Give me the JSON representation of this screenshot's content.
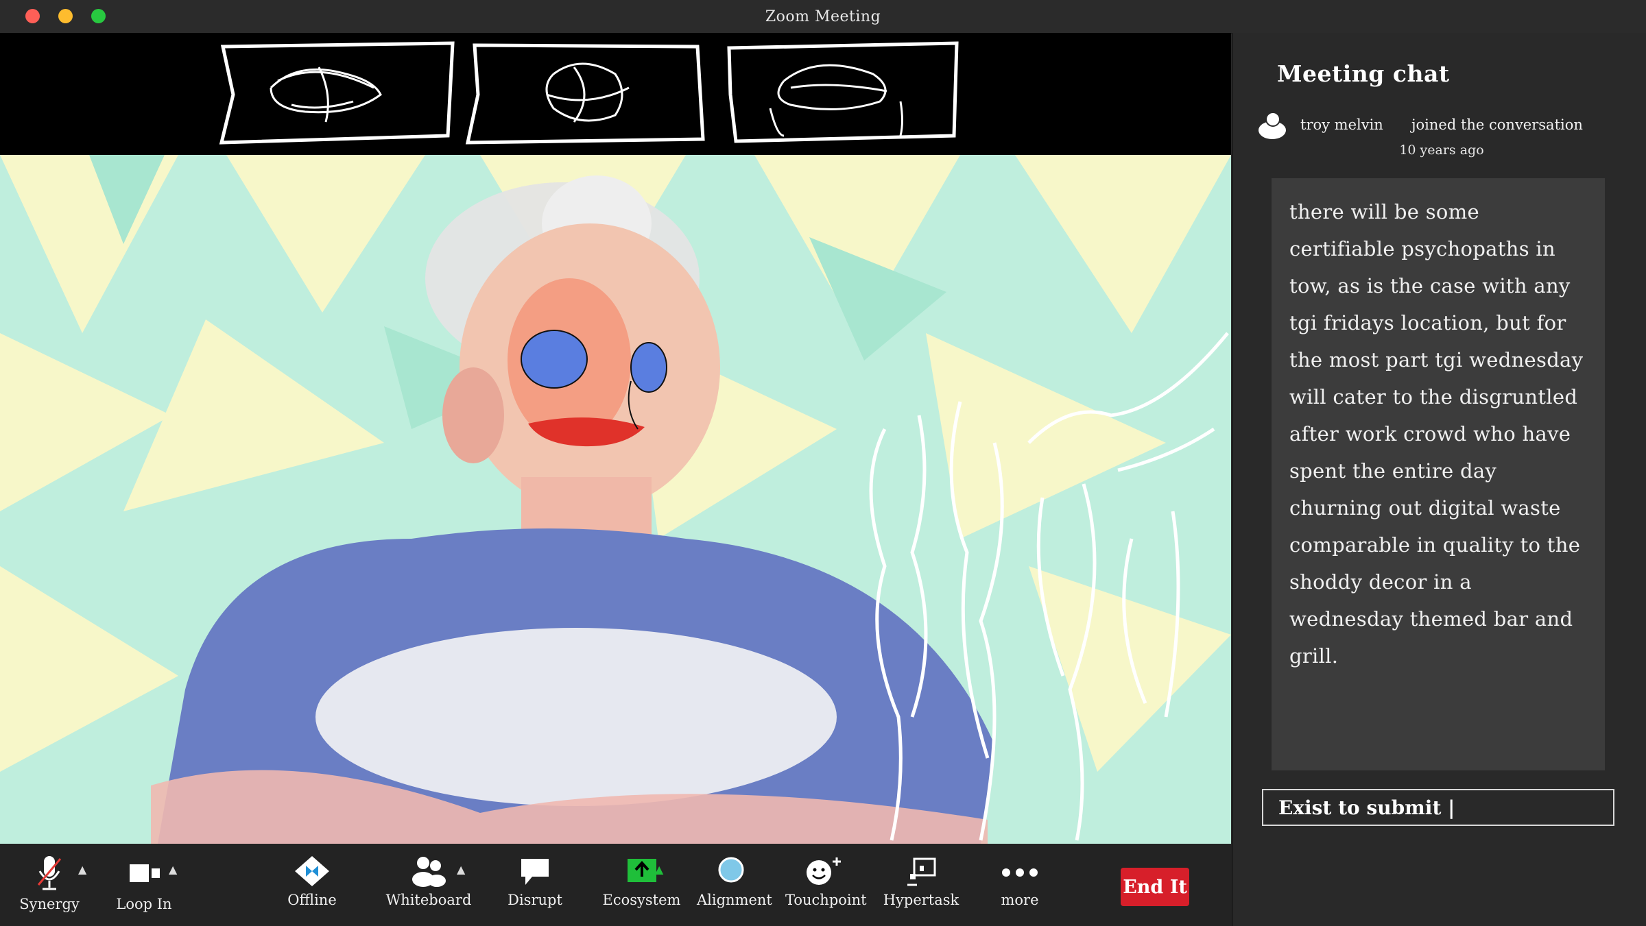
{
  "window": {
    "title": "Zoom Meeting"
  },
  "chat": {
    "title": "Meeting chat",
    "join": {
      "name": "troy melvin",
      "text": "joined the conversation",
      "time": "10 years ago"
    },
    "message": "there will be some certifiable psychopaths in tow, as is the case with any tgi fridays location, but for the most part tgi wednesday will cater to the disgruntled after work crowd who have spent the entire day churning out digital waste comparable in quality to the shoddy decor in a wednesday themed bar and grill.",
    "input_value": "Exist to submit |"
  },
  "toolbar": {
    "items": [
      {
        "label": "Synergy"
      },
      {
        "label": "Loop In"
      },
      {
        "label": "Offline"
      },
      {
        "label": "Whiteboard"
      },
      {
        "label": "Disrupt"
      },
      {
        "label": "Ecosystem"
      },
      {
        "label": "Alignment"
      },
      {
        "label": "Touchpoint"
      },
      {
        "label": "Hypertask"
      },
      {
        "label": "more"
      }
    ],
    "end_label": "End It"
  },
  "colors": {
    "end_button": "#d71f2a",
    "ecosystem_icon": "#1fbf3a",
    "alignment_icon": "#7fc8e8",
    "background_mint": "#b8ebd8",
    "background_cream": "#f7f7c9"
  }
}
